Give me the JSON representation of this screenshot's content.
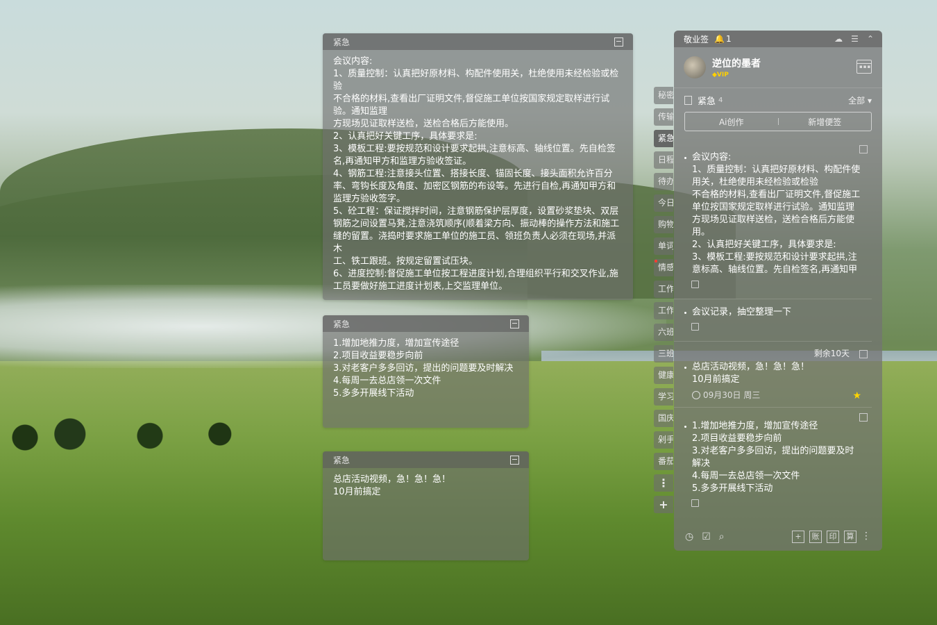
{
  "notes": [
    {
      "tag": "紧急",
      "content": "会议内容:\n1、质量控制：认真把好原材料、构配件使用关，杜绝使用未经检验或检验\n不合格的材料,查看出厂证明文件,督促施工单位按国家规定取样进行试验。通知监理\n方现场见证取样送检，送检合格后方能使用。\n2、认真把好关键工序，具体要求是:\n3、模板工程:要按规范和设计要求起拱,注意标高、轴线位置。先自检签名,再通知甲方和监理方验收签证。\n4、钢筋工程:注意接头位置、搭接长度、锚固长度、接头面积允许百分率、弯钩长度及角度、加密区钢筋的布设等。先进行自检,再通知甲方和监理方验收签字。\n5、砼工程：保证搅拌时间，注意钢筋保护层厚度，设置砂浆垫块、双层钢筋之间设置马凳,注意浇筑顺序(顺着梁方向、振动棒的操作方法和施工缝的留置。浇捣时要求施工单位的施工员、领班负责人必须在现场,并派木\n工、铁工跟班。按规定留置试压块。\n6、进度控制:督促施工单位按工程进度计划,合理组织平行和交叉作业,施工员要做好施工进度计划表,上交监理单位。"
    },
    {
      "tag": "紧急",
      "content": "1.增加地推力度，增加宣传途径\n2.项目收益要稳步向前\n3.对老客户多多回访，提出的问题要及时解决\n4.每周一去总店领一次文件\n5.多多开展线下活动"
    },
    {
      "tag": "紧急",
      "content": "总店活动视频，急！急！急！\n10月前搞定"
    }
  ],
  "tags": [
    "秘密",
    "传输",
    "紧急",
    "日程",
    "待办",
    "今日",
    "购物",
    "单词",
    "情感",
    "工作",
    "工作",
    "六班",
    "三班",
    "健康",
    "学习",
    "国庆",
    "剁手",
    "番茄"
  ],
  "tag_buttons": {
    "more": "⋮",
    "add": "+"
  },
  "panel": {
    "app_name": "敬业签",
    "bell_count": "1",
    "username": "逆位的墨者",
    "vip": "VIP",
    "category": "紧急",
    "category_count": "4",
    "filter": "全部 ▾",
    "ai_button": "Ai创作",
    "new_button": "新增便签",
    "items": [
      {
        "text": "会议内容:\n1、质量控制：认真把好原材料、构配件使用关，杜绝使用未经检验或检验\n不合格的材料,查看出厂证明文件,督促施工单位按国家规定取样进行试验。通知监理\n方现场见证取样送检，送检合格后方能使用。\n2、认真把好关键工序，具体要求是:\n3、模板工程:要按规范和设计要求起拱,注意标高、轴线位置。先自检签名,再通知甲方和监理方验收签证。"
      },
      {
        "text": "会议记录，抽空整理一下"
      },
      {
        "text": "总店活动视频，急！急！急！\n10月前搞定",
        "remain": "剩余10天",
        "date": "09月30日 周三"
      },
      {
        "text": "1.增加地推力度，增加宣传途径\n2.项目收益要稳步向前\n3.对老客户多多回访，提出的问题要及时解决\n4.每周一去总店领一次文件\n5.多多开展线下活动"
      }
    ],
    "bottom": {
      "b1": "账",
      "b2": "印",
      "b3": "算",
      "plus": "+"
    }
  }
}
